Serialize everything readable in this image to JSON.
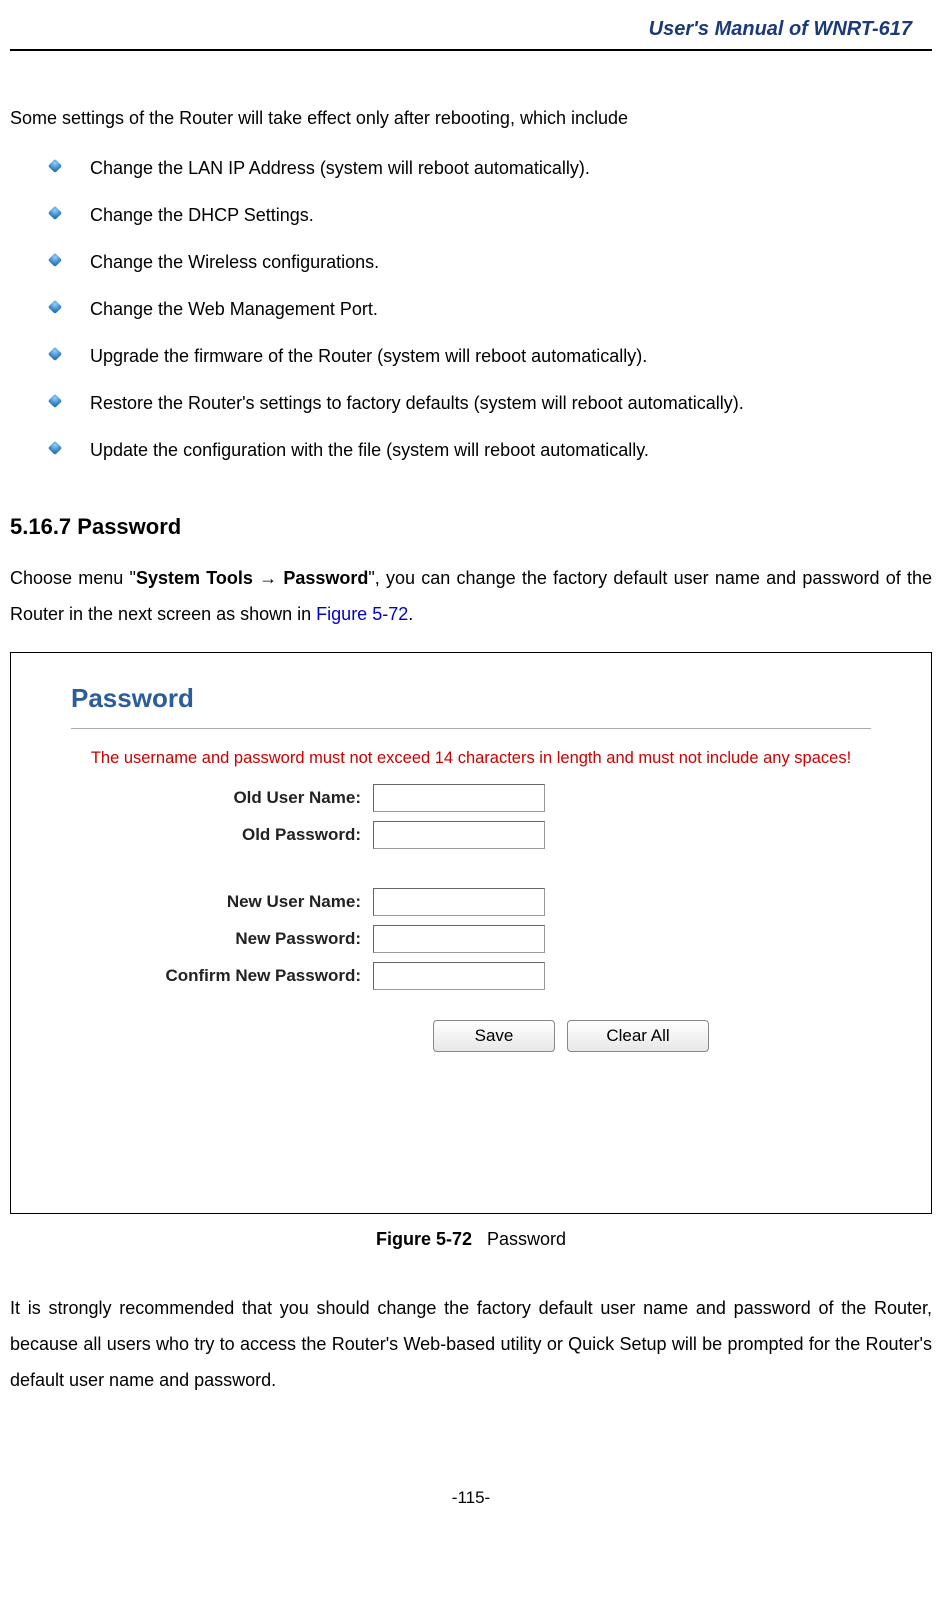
{
  "header": {
    "title": "User's Manual of WNRT-617"
  },
  "intro": "Some settings of the Router will take effect only after rebooting, which include",
  "bullets": [
    "Change the LAN IP Address (system will reboot automatically).",
    "Change the DHCP Settings.",
    "Change the Wireless configurations.",
    "Change the Web Management Port.",
    "Upgrade the firmware of the Router (system will reboot automatically).",
    "Restore the Router's settings to factory defaults (system will reboot automatically).",
    "Update the configuration with the file (system will reboot automatically."
  ],
  "section": {
    "heading": "5.16.7 Password",
    "para_pre": "Choose menu \"",
    "para_bold": "System Tools → Password",
    "para_mid": "\", you can change the factory default user name and password of the Router in the next screen as shown in ",
    "para_link": "Figure 5-72",
    "para_end": "."
  },
  "figure": {
    "panel_title": "Password",
    "warning": "The username and password must not exceed 14 characters in length and must not include any spaces!",
    "labels": {
      "old_user": "Old User Name:",
      "old_pass": "Old Password:",
      "new_user": "New User Name:",
      "new_pass": "New Password:",
      "confirm": "Confirm New Password:"
    },
    "buttons": {
      "save": "Save",
      "clear": "Clear All"
    },
    "caption_bold": "Figure 5-72",
    "caption_rest": "Password"
  },
  "closing": "It is strongly recommended that you should change the factory default user name and password of the Router, because all users who try to access the Router's Web-based utility or Quick Setup will be prompted for the Router's default user name and password.",
  "page_number": "-115-"
}
